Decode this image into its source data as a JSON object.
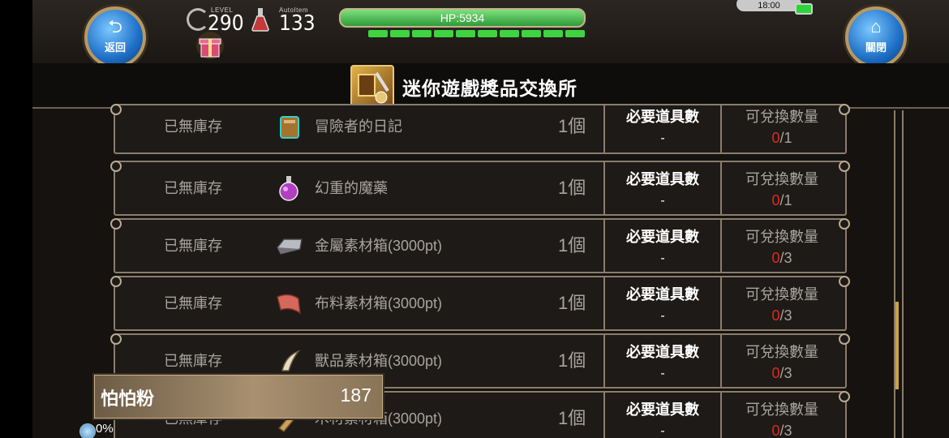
{
  "hud": {
    "back_label": "返回",
    "close_label": "關閉",
    "level_caption": "LEVEL",
    "level_value": "290",
    "autoitem_caption": "AutoItem",
    "autoitem_value": "133",
    "hp_text": "HP:5934",
    "hp_segments_filled": 10,
    "clock": "18:00"
  },
  "title": "迷你遊戲獎品交換所",
  "columns": {
    "required_header": "必要道具數",
    "exchange_header": "可兌換數量"
  },
  "rows": [
    {
      "stock": "已無庫存",
      "icon": "book-icon",
      "name": "冒險者的日記",
      "qty": "1個",
      "required": "-",
      "exch_current": "0",
      "exch_max": "/1"
    },
    {
      "stock": "已無庫存",
      "icon": "potion-icon",
      "name": "幻重的魔藥",
      "qty": "1個",
      "required": "-",
      "exch_current": "0",
      "exch_max": "/1"
    },
    {
      "stock": "已無庫存",
      "icon": "metal-ingot-icon",
      "name": "金屬素材箱(3000pt)",
      "qty": "1個",
      "required": "-",
      "exch_current": "0",
      "exch_max": "/3"
    },
    {
      "stock": "已無庫存",
      "icon": "cloth-icon",
      "name": "布料素材箱(3000pt)",
      "qty": "1個",
      "required": "-",
      "exch_current": "0",
      "exch_max": "/3"
    },
    {
      "stock": "已無庫存",
      "icon": "fang-icon",
      "name": "獸品素材箱(3000pt)",
      "qty": "1個",
      "required": "-",
      "exch_current": "0",
      "exch_max": "/3"
    },
    {
      "stock": "已無庫存",
      "icon": "wood-icon",
      "name": "木材素材箱(3000pt)",
      "qty": "1個",
      "required": "-",
      "exch_current": "0",
      "exch_max": "/3"
    }
  ],
  "currency": {
    "name": "怕怕粉",
    "value": "187"
  },
  "exp_text": "0%",
  "colors": {
    "accent_red": "#e02a1c",
    "hp_green": "#3fd43f",
    "frame": "#8a7d6b"
  }
}
